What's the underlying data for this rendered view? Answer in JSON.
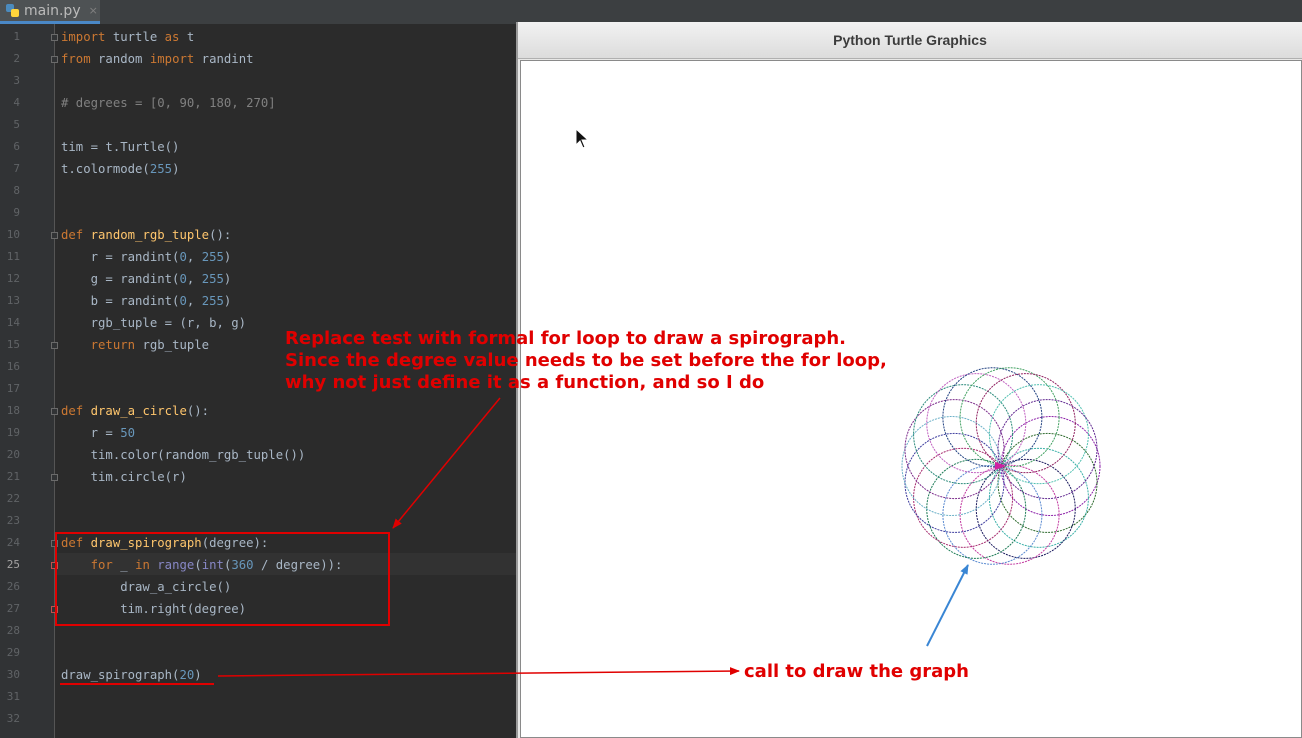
{
  "tab": {
    "filename": "main.py",
    "close": "×"
  },
  "editor": {
    "current_line": 25,
    "lines": [
      [
        {
          "t": "import",
          "c": "kw"
        },
        {
          "t": " turtle "
        },
        {
          "t": "as",
          "c": "kw"
        },
        {
          "t": " t"
        }
      ],
      [
        {
          "t": "from",
          "c": "kw"
        },
        {
          "t": " random "
        },
        {
          "t": "import",
          "c": "kw"
        },
        {
          "t": " randint"
        }
      ],
      [],
      [
        {
          "t": "# degrees = [0, 90, 180, 270]",
          "c": "cm"
        }
      ],
      [],
      [
        {
          "t": "tim = t.Turtle()"
        }
      ],
      [
        {
          "t": "t.colormode("
        },
        {
          "t": "255",
          "c": "num"
        },
        {
          "t": ")"
        }
      ],
      [],
      [],
      [
        {
          "t": "def ",
          "c": "kw"
        },
        {
          "t": "random_rgb_tuple",
          "c": "fn"
        },
        {
          "t": "():"
        }
      ],
      [
        {
          "t": "    r = randint("
        },
        {
          "t": "0",
          "c": "num"
        },
        {
          "t": ", "
        },
        {
          "t": "255",
          "c": "num"
        },
        {
          "t": ")"
        }
      ],
      [
        {
          "t": "    g = randint("
        },
        {
          "t": "0",
          "c": "num"
        },
        {
          "t": ", "
        },
        {
          "t": "255",
          "c": "num"
        },
        {
          "t": ")"
        }
      ],
      [
        {
          "t": "    b = randint("
        },
        {
          "t": "0",
          "c": "num"
        },
        {
          "t": ", "
        },
        {
          "t": "255",
          "c": "num"
        },
        {
          "t": ")"
        }
      ],
      [
        {
          "t": "    rgb_tuple = (r, b, g)"
        }
      ],
      [
        {
          "t": "    "
        },
        {
          "t": "return",
          "c": "kw"
        },
        {
          "t": " rgb_tuple"
        }
      ],
      [],
      [],
      [
        {
          "t": "def ",
          "c": "kw"
        },
        {
          "t": "draw_a_circle",
          "c": "fn"
        },
        {
          "t": "():"
        }
      ],
      [
        {
          "t": "    r = "
        },
        {
          "t": "50",
          "c": "num"
        }
      ],
      [
        {
          "t": "    tim.color(random_rgb_tuple())"
        }
      ],
      [
        {
          "t": "    tim.circle(r)"
        }
      ],
      [],
      [],
      [
        {
          "t": "def ",
          "c": "kw"
        },
        {
          "t": "draw_spirograph",
          "c": "fn"
        },
        {
          "t": "(degree):"
        }
      ],
      [
        {
          "t": "    "
        },
        {
          "t": "for",
          "c": "kw"
        },
        {
          "t": " _ "
        },
        {
          "t": "in",
          "c": "kw"
        },
        {
          "t": " "
        },
        {
          "t": "range",
          "c": "bi"
        },
        {
          "t": "("
        },
        {
          "t": "int",
          "c": "bi"
        },
        {
          "t": "("
        },
        {
          "t": "360",
          "c": "num"
        },
        {
          "t": " / degree)):"
        }
      ],
      [
        {
          "t": "        draw_a_circle()"
        }
      ],
      [
        {
          "t": "        tim.right(degree)"
        }
      ],
      [],
      [],
      [
        {
          "t": "draw_spirograph("
        },
        {
          "t": "20",
          "c": "num"
        },
        {
          "t": ")"
        }
      ],
      [],
      []
    ]
  },
  "turtle_window": {
    "title": "Python Turtle Graphics",
    "spirograph": {
      "circles": 18,
      "radius": 50,
      "degree": 20
    }
  },
  "annotations": {
    "note_line1": "Replace test with formal for loop to draw a spirograph.",
    "note_line2": "Since the degree value needs to be set before the for loop,",
    "note_line3": "why not just define it as a function, and so I do",
    "call_note": "call to draw the graph"
  },
  "colors": {
    "annotation_red": "#e00000",
    "arrow_blue": "#3a86d4",
    "editor_bg": "#2b2b2b",
    "canvas_bg": "#ffffff"
  }
}
